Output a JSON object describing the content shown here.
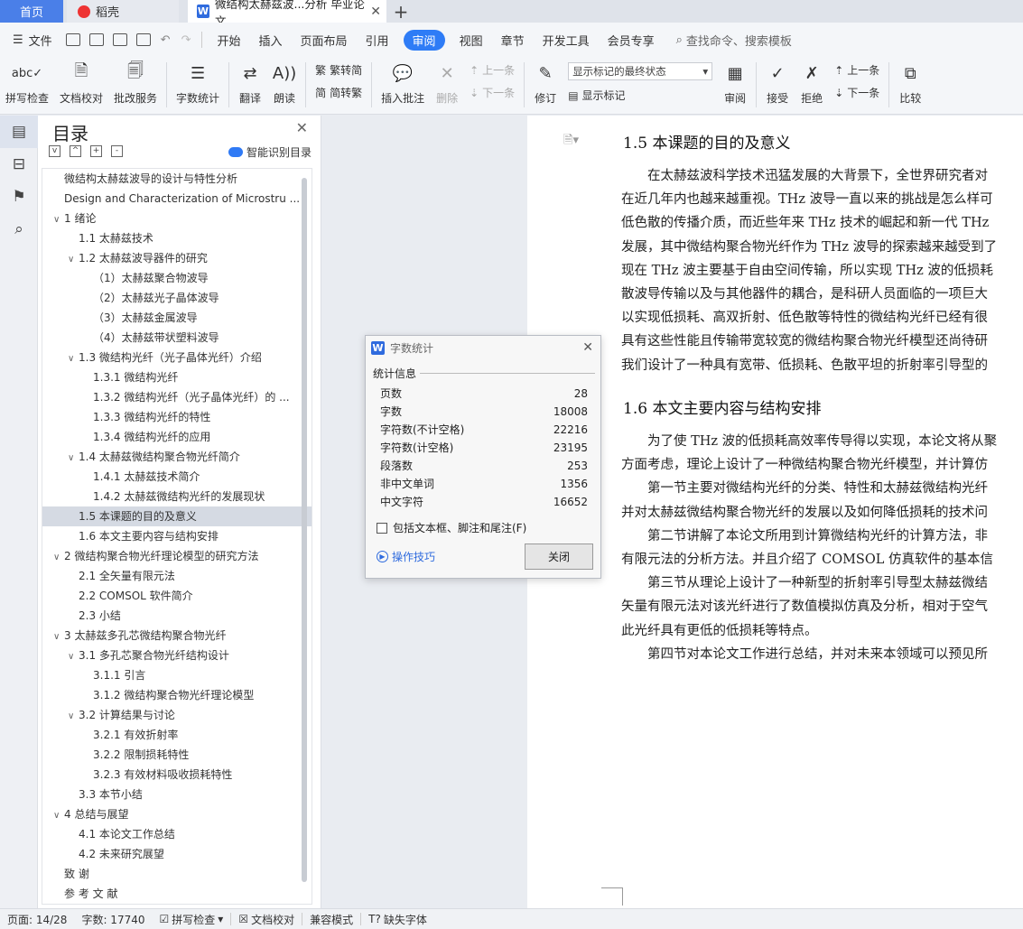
{
  "tabs": {
    "home": "首页",
    "daoke": "稻壳",
    "doc": "微结构太赫兹波...分析 毕业论文",
    "close": "✕",
    "add": "+"
  },
  "menu": {
    "file": "文件",
    "items": [
      "开始",
      "插入",
      "页面布局",
      "引用",
      "审阅",
      "视图",
      "章节",
      "开发工具",
      "会员专享"
    ],
    "search": "查找命令、搜索模板"
  },
  "ribbon": {
    "spell_check": "拼写检查",
    "doc_proof": "文档校对",
    "batch_service": "批改服务",
    "word_count": "字数统计",
    "translate": "翻译",
    "read_aloud": "朗读",
    "trad": "繁转简",
    "simp": "简转繁",
    "insert_comment": "插入批注",
    "delete": "删除",
    "prev_comment": "上一条",
    "next_comment": "下一条",
    "track_changes": "修订",
    "markup_select": "显示标记的最终状态",
    "show_markup": "显示标记",
    "review": "审阅",
    "accept": "接受",
    "reject": "拒绝",
    "prev_change": "上一条",
    "next_change": "下一条",
    "compare": "比较"
  },
  "toc": {
    "title": "目录",
    "smart": "智能识别目录",
    "items": [
      {
        "text": "微结构太赫兹波导的设计与特性分析",
        "indent": 0,
        "caret": ""
      },
      {
        "text": "Design and Characterization of Microstru ...",
        "indent": 0,
        "caret": ""
      },
      {
        "text": "1  绪论",
        "indent": 0,
        "caret": "v"
      },
      {
        "text": "1.1  太赫兹技术",
        "indent": 1,
        "caret": ""
      },
      {
        "text": "1.2  太赫兹波导器件的研究",
        "indent": 1,
        "caret": "v"
      },
      {
        "text": "（1）太赫兹聚合物波导",
        "indent": 2,
        "caret": ""
      },
      {
        "text": "（2）太赫兹光子晶体波导",
        "indent": 2,
        "caret": ""
      },
      {
        "text": "（3）太赫兹金属波导",
        "indent": 2,
        "caret": ""
      },
      {
        "text": "（4）太赫兹带状塑料波导",
        "indent": 2,
        "caret": ""
      },
      {
        "text": "1.3  微结构光纤（光子晶体光纤）介绍",
        "indent": 1,
        "caret": "v"
      },
      {
        "text": "1.3.1  微结构光纤",
        "indent": 2,
        "caret": ""
      },
      {
        "text": "1.3.2  微结构光纤（光子晶体光纤）的 ...",
        "indent": 2,
        "caret": ""
      },
      {
        "text": "1.3.3  微结构光纤的特性",
        "indent": 2,
        "caret": ""
      },
      {
        "text": "1.3.4  微结构光纤的应用",
        "indent": 2,
        "caret": ""
      },
      {
        "text": "1.4  太赫兹微结构聚合物光纤简介",
        "indent": 1,
        "caret": "v"
      },
      {
        "text": "1.4.1  太赫兹技术简介",
        "indent": 2,
        "caret": ""
      },
      {
        "text": "1.4.2  太赫兹微结构光纤的发展现状",
        "indent": 2,
        "caret": ""
      },
      {
        "text": "1.5  本课题的目的及意义",
        "indent": 1,
        "caret": "",
        "selected": true
      },
      {
        "text": "1.6  本文主要内容与结构安排",
        "indent": 1,
        "caret": ""
      },
      {
        "text": "2  微结构聚合物光纤理论模型的研究方法",
        "indent": 0,
        "caret": "v"
      },
      {
        "text": "2.1  全矢量有限元法",
        "indent": 1,
        "caret": ""
      },
      {
        "text": "2.2 COMSOL 软件简介",
        "indent": 1,
        "caret": ""
      },
      {
        "text": "2.3  小结",
        "indent": 1,
        "caret": ""
      },
      {
        "text": "3  太赫兹多孔芯微结构聚合物光纤",
        "indent": 0,
        "caret": "v"
      },
      {
        "text": "3.1  多孔芯聚合物光纤结构设计",
        "indent": 1,
        "caret": "v"
      },
      {
        "text": "3.1.1  引言",
        "indent": 2,
        "caret": ""
      },
      {
        "text": "3.1.2  微结构聚合物光纤理论模型",
        "indent": 2,
        "caret": ""
      },
      {
        "text": "3.2  计算结果与讨论",
        "indent": 1,
        "caret": "v"
      },
      {
        "text": "3.2.1  有效折射率",
        "indent": 2,
        "caret": ""
      },
      {
        "text": "3.2.2  限制损耗特性",
        "indent": 2,
        "caret": ""
      },
      {
        "text": "3.2.3  有效材料吸收损耗特性",
        "indent": 2,
        "caret": ""
      },
      {
        "text": "3.3  本节小结",
        "indent": 1,
        "caret": ""
      },
      {
        "text": "4  总结与展望",
        "indent": 0,
        "caret": "v"
      },
      {
        "text": "4.1  本论文工作总结",
        "indent": 1,
        "caret": ""
      },
      {
        "text": "4.2  未来研究展望",
        "indent": 1,
        "caret": ""
      },
      {
        "text": "致  谢",
        "indent": 0,
        "caret": ""
      },
      {
        "text": "参 考 文 献",
        "indent": 0,
        "caret": ""
      }
    ]
  },
  "document": {
    "heading1": "1.5  本课题的目的及意义",
    "para1": [
      "　　在太赫兹波科学技术迅猛发展的大背景下，全世界研究者对",
      "在近几年内也越来越重视。THz 波导一直以来的挑战是怎么样可",
      "低色散的传播介质，而近些年来 THz 技术的崛起和新一代 THz ",
      "发展，其中微结构聚合物光纤作为 THz 波导的探索越来越受到了",
      "现在 THz 波主要基于自由空间传输，所以实现 THz 波的低损耗",
      "散波导传输以及与其他器件的耦合，是科研人员面临的一项巨大",
      "以实现低损耗、高双折射、低色散等特性的微结构光纤已经有很",
      "具有这些性能且传输带宽较宽的微结构聚合物光纤模型还尚待研",
      "我们设计了一种具有宽带、低损耗、色散平坦的折射率引导型的"
    ],
    "heading2": "1.6  本文主要内容与结构安排",
    "para2": [
      "　　为了使 THz 波的低损耗高效率传导得以实现，本论文将从聚",
      "方面考虑，理论上设计了一种微结构聚合物光纤模型，并计算仿",
      "　　第一节主要对微结构光纤的分类、特性和太赫兹微结构光纤",
      "并对太赫兹微结构聚合物光纤的发展以及如何降低损耗的技术问",
      "　　第二节讲解了本论文所用到计算微结构光纤的计算方法，非",
      "有限元法的分析方法。并且介绍了 COMSOL 仿真软件的基本信",
      "　　第三节从理论上设计了一种新型的折射率引导型太赫兹微结",
      "矢量有限元法对该光纤进行了数值模拟仿真及分析，相对于空气",
      "此光纤具有更低的低损耗等特点。",
      "　　第四节对本论文工作进行总结，并对未来本领域可以预见所"
    ]
  },
  "dialog": {
    "title": "字数统计",
    "section": "统计信息",
    "rows": [
      {
        "label": "页数",
        "value": "28"
      },
      {
        "label": "字数",
        "value": "18008"
      },
      {
        "label": "字符数(不计空格)",
        "value": "22216"
      },
      {
        "label": "字符数(计空格)",
        "value": "23195"
      },
      {
        "label": "段落数",
        "value": "253"
      },
      {
        "label": "非中文单词",
        "value": "1356"
      },
      {
        "label": "中文字符",
        "value": "16652"
      }
    ],
    "checkbox": "包括文本框、脚注和尾注(F)",
    "tips": "操作技巧",
    "close_btn": "关闭"
  },
  "status": {
    "page": "页面: 14/28",
    "words": "字数: 17740",
    "spell": "拼写检查",
    "proof": "文档校对",
    "compat": "兼容模式",
    "missing_font": "缺失字体"
  },
  "colors": {
    "accent": "#2e7cf6",
    "home_tab": "#4a7fe8"
  }
}
